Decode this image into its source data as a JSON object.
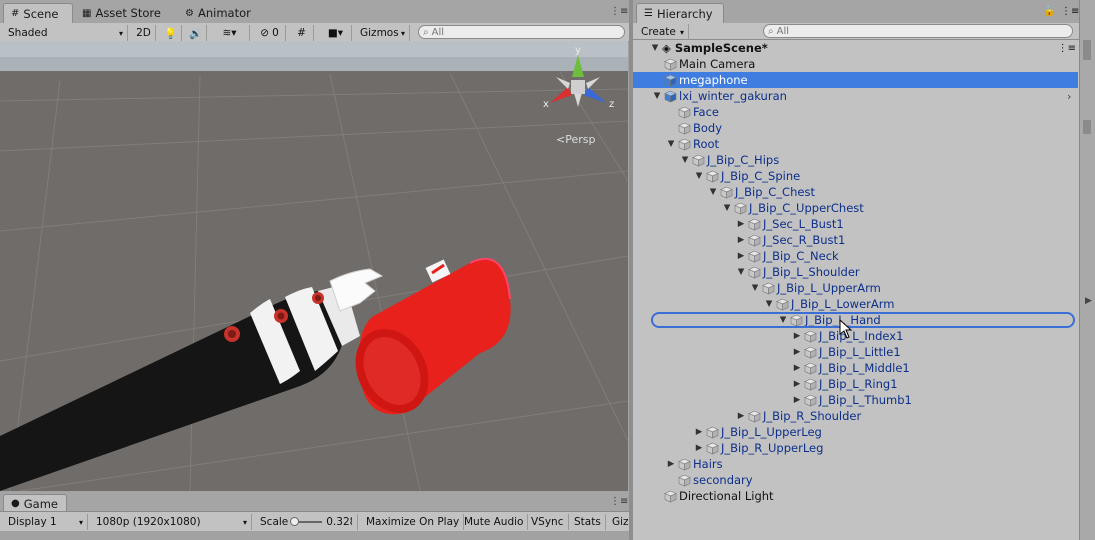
{
  "scene_tabs": [
    {
      "label": "Scene",
      "icon": "scene-icon"
    },
    {
      "label": "Asset Store",
      "icon": "store-icon"
    },
    {
      "label": "Animator",
      "icon": "animator-icon"
    }
  ],
  "scene_toolbar": {
    "draw_mode": "Shaded",
    "mode_2d": "2D",
    "hidden_count": "0",
    "gizmos": "Gizmos",
    "search_placeholder": "All"
  },
  "scene_view": {
    "persp_label": "Persp",
    "axis_x": "x",
    "axis_y": "y",
    "axis_z": "z"
  },
  "hierarchy": {
    "tab_label": "Hierarchy",
    "create_label": "Create",
    "search_placeholder": "All",
    "scene_name": "SampleScene*",
    "items": [
      {
        "label": "Main Camera",
        "depth": 1,
        "arrow": "",
        "state": "normal"
      },
      {
        "label": "megaphone",
        "depth": 1,
        "arrow": "",
        "state": "selected"
      },
      {
        "label": "lxi_winter_gakuran",
        "depth": 1,
        "arrow": "expanded",
        "state": "blue"
      },
      {
        "label": "Face",
        "depth": 2,
        "arrow": "",
        "state": "blue"
      },
      {
        "label": "Body",
        "depth": 2,
        "arrow": "",
        "state": "blue"
      },
      {
        "label": "Root",
        "depth": 2,
        "arrow": "expanded",
        "state": "blue"
      },
      {
        "label": "J_Bip_C_Hips",
        "depth": 3,
        "arrow": "expanded",
        "state": "blue"
      },
      {
        "label": "J_Bip_C_Spine",
        "depth": 4,
        "arrow": "expanded",
        "state": "blue"
      },
      {
        "label": "J_Bip_C_Chest",
        "depth": 5,
        "arrow": "expanded",
        "state": "blue"
      },
      {
        "label": "J_Bip_C_UpperChest",
        "depth": 6,
        "arrow": "expanded",
        "state": "blue"
      },
      {
        "label": "J_Sec_L_Bust1",
        "depth": 7,
        "arrow": "collapsed",
        "state": "blue"
      },
      {
        "label": "J_Sec_R_Bust1",
        "depth": 7,
        "arrow": "collapsed",
        "state": "blue"
      },
      {
        "label": "J_Bip_C_Neck",
        "depth": 7,
        "arrow": "collapsed",
        "state": "blue"
      },
      {
        "label": "J_Bip_L_Shoulder",
        "depth": 7,
        "arrow": "expanded",
        "state": "blue"
      },
      {
        "label": "J_Bip_L_UpperArm",
        "depth": 8,
        "arrow": "expanded",
        "state": "blue"
      },
      {
        "label": "J_Bip_L_LowerArm",
        "depth": 9,
        "arrow": "expanded",
        "state": "blue"
      },
      {
        "label": "J_Bip_L_Hand",
        "depth": 10,
        "arrow": "expanded",
        "state": "blue"
      },
      {
        "label": "J_Bip_L_Index1",
        "depth": 11,
        "arrow": "collapsed",
        "state": "blue"
      },
      {
        "label": "J_Bip_L_Little1",
        "depth": 11,
        "arrow": "collapsed",
        "state": "blue"
      },
      {
        "label": "J_Bip_L_Middle1",
        "depth": 11,
        "arrow": "collapsed",
        "state": "blue"
      },
      {
        "label": "J_Bip_L_Ring1",
        "depth": 11,
        "arrow": "collapsed",
        "state": "blue"
      },
      {
        "label": "J_Bip_L_Thumb1",
        "depth": 11,
        "arrow": "collapsed",
        "state": "blue"
      },
      {
        "label": "J_Bip_R_Shoulder",
        "depth": 7,
        "arrow": "collapsed",
        "state": "blue"
      },
      {
        "label": "J_Bip_L_UpperLeg",
        "depth": 4,
        "arrow": "collapsed",
        "state": "blue"
      },
      {
        "label": "J_Bip_R_UpperLeg",
        "depth": 4,
        "arrow": "collapsed",
        "state": "blue"
      },
      {
        "label": "Hairs",
        "depth": 2,
        "arrow": "collapsed",
        "state": "blue"
      },
      {
        "label": "secondary",
        "depth": 2,
        "arrow": "",
        "state": "blue"
      },
      {
        "label": "Directional Light",
        "depth": 1,
        "arrow": "",
        "state": "normal"
      }
    ]
  },
  "game": {
    "tab_label": "Game",
    "display": "Display 1",
    "resolution": "1080p (1920x1080)",
    "scale_label": "Scale",
    "scale_value": "0.328",
    "maximize": "Maximize On Play",
    "mute": "Mute Audio",
    "vsync": "VSync",
    "stats": "Stats",
    "gizmos": "Giz"
  },
  "colors": {
    "selection": "#3f7de0",
    "prefab_text": "#0c2f8a",
    "scene_bg": "#6f6c69",
    "panel_bg": "#c2c2c2"
  }
}
